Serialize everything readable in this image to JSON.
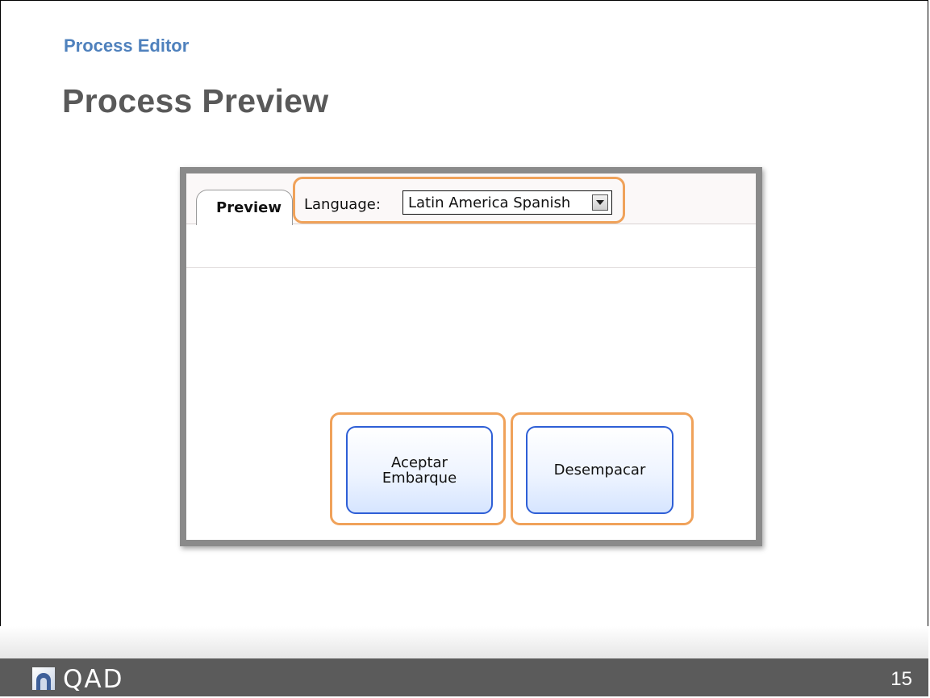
{
  "slide": {
    "section": "Process Editor",
    "title": "Process Preview",
    "page_number": "15"
  },
  "preview": {
    "tab_label": "Preview",
    "language_label": "Language:",
    "language_selected": "Latin America Spanish",
    "buttons": [
      {
        "label": "Aceptar\nEmbarque"
      },
      {
        "label": "Desempacar"
      }
    ]
  },
  "footer": {
    "logo_text": "QAD",
    "logo_icon": "qad-logo-icon"
  },
  "colors": {
    "section_title": "#4f81bd",
    "title": "#595959",
    "highlight": "#f0a25a",
    "button_border": "#2e5fd6",
    "footer_bar": "#5b5b5b"
  }
}
